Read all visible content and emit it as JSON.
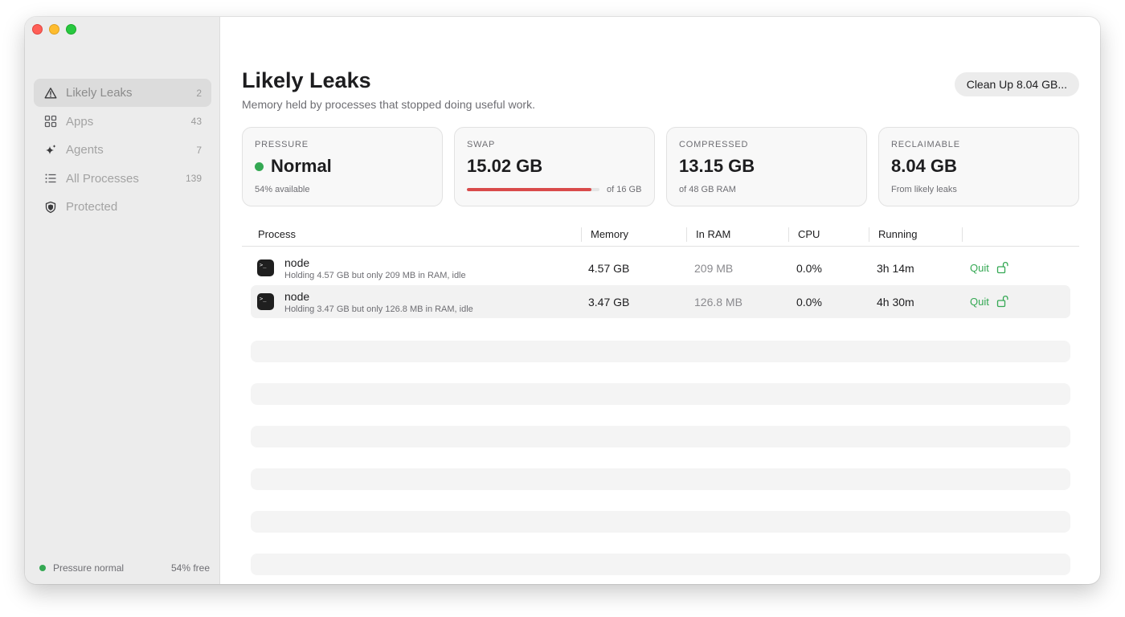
{
  "sidebar": {
    "items": [
      {
        "label": "Likely Leaks",
        "count": "2",
        "icon": "warning-triangle-icon"
      },
      {
        "label": "Apps",
        "count": "43",
        "icon": "grid-icon"
      },
      {
        "label": "Agents",
        "count": "7",
        "icon": "sparkle-icon"
      },
      {
        "label": "All Processes",
        "count": "139",
        "icon": "list-icon"
      },
      {
        "label": "Protected",
        "count": "",
        "icon": "shield-icon"
      }
    ],
    "footer": {
      "status": "Pressure normal",
      "free": "54% free"
    }
  },
  "header": {
    "title": "Likely Leaks",
    "subtitle": "Memory held by processes that stopped doing useful work.",
    "cleanup_label": "Clean Up 8.04 GB..."
  },
  "cards": {
    "pressure": {
      "label": "PRESSURE",
      "value": "Normal",
      "sub": "54% available"
    },
    "swap": {
      "label": "SWAP",
      "value": "15.02 GB",
      "of": "of 16 GB",
      "fill_fraction": 0.94
    },
    "compressed": {
      "label": "COMPRESSED",
      "value": "13.15 GB",
      "sub": "of 48 GB RAM"
    },
    "reclaimable": {
      "label": "RECLAIMABLE",
      "value": "8.04 GB",
      "sub": "From likely leaks"
    }
  },
  "table": {
    "headers": {
      "process": "Process",
      "memory": "Memory",
      "in_ram": "In RAM",
      "cpu": "CPU",
      "running": "Running"
    },
    "rows": [
      {
        "name": "node",
        "desc": "Holding 4.57 GB but only 209 MB in RAM, idle",
        "memory": "4.57 GB",
        "in_ram": "209 MB",
        "cpu": "0.0%",
        "running": "3h 14m",
        "action": "Quit"
      },
      {
        "name": "node",
        "desc": "Holding 3.47 GB but only 126.8 MB in RAM, idle",
        "memory": "3.47 GB",
        "in_ram": "126.8 MB",
        "cpu": "0.0%",
        "running": "4h 30m",
        "action": "Quit"
      }
    ]
  },
  "colors": {
    "accent_green": "#34a853",
    "swap_red": "#d94b4b"
  }
}
